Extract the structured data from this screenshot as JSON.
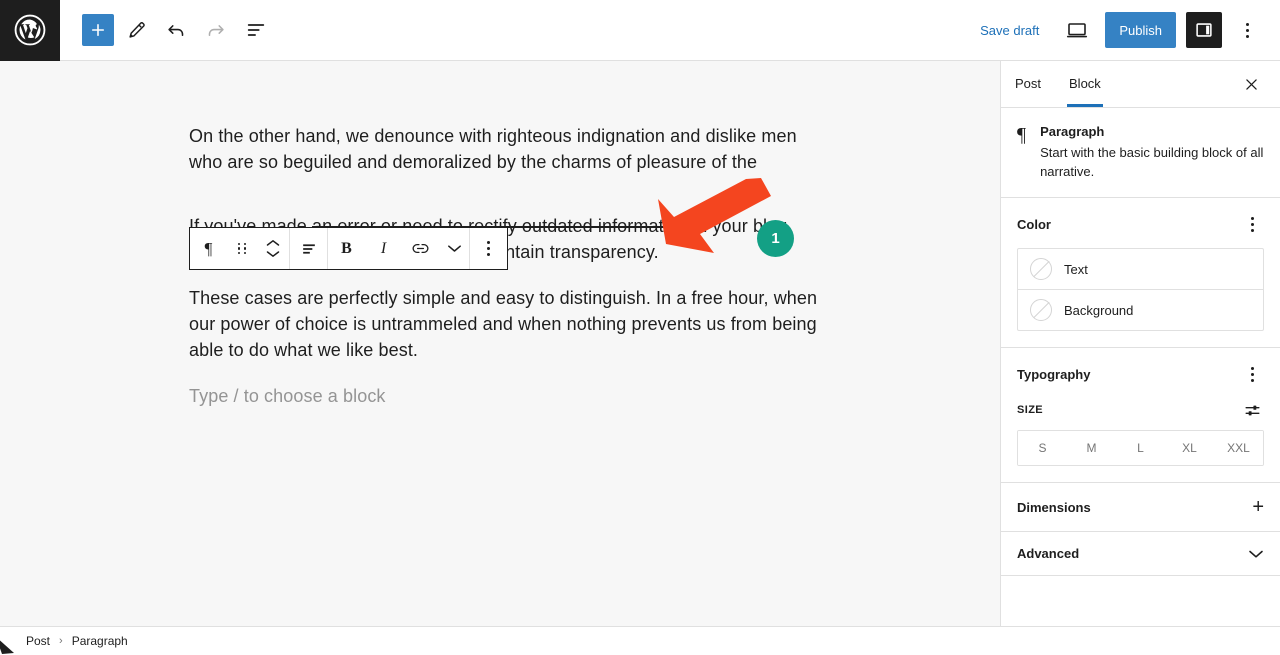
{
  "topbar": {
    "logo_icon": "wordpress-logo-icon",
    "add_block_label": "+",
    "add_block_icon": "plus-icon",
    "tools_icon": "pencil-edit-icon",
    "undo_icon": "undo-arrow-icon",
    "redo_icon": "redo-arrow-icon",
    "list_view_icon": "document-list-view-icon",
    "save_draft_label": "Save draft",
    "preview_icon": "desktop-preview-icon",
    "publish_label": "Publish",
    "sidebar_toggle_icon": "settings-panel-icon",
    "options_icon": "vertical-ellipsis-icon",
    "accent_blue": "#3582c4",
    "link_blue": "#1d70b8",
    "dark": "#1e1e1e"
  },
  "block_toolbar": {
    "block_type_icon": "paragraph-pilcrow-icon",
    "block_type_glyph": "¶",
    "drag_icon": "drag-handle-icon",
    "move_up_icon": "chevron-up-icon",
    "move_down_icon": "chevron-down-icon",
    "align_icon": "text-align-left-icon",
    "bold_label": "B",
    "italic_label": "I",
    "link_icon": "link-chain-icon",
    "more_formats_icon": "chevron-down-icon",
    "options_icon": "vertical-ellipsis-icon"
  },
  "editor": {
    "paragraph_1_line_1": "On the other hand, we denounce with righteous indignation and dislike men",
    "paragraph_1_line_2": "who are so beguiled and demoralized by the charms of pleasure of the",
    "paragraph_2_prefix": "If you've made ",
    "paragraph_2_strike": "an error or need to rectify outdated information",
    "paragraph_2_suffix": " in your blog post, using strikethrough helps you maintain transparency.",
    "paragraph_3": "These cases are perfectly simple and easy to distinguish. In a free hour, when our power of choice is untrammeled and when nothing prevents us from being able to do what we like best.",
    "placeholder": "Type / to choose a block"
  },
  "annotation": {
    "badge_number": "1",
    "badge_color": "#13a085",
    "arrow_color": "#f4451f",
    "arrow_icon": "pointer-arrow-icon"
  },
  "sidebar": {
    "tabs": [
      {
        "label": "Post",
        "active": false
      },
      {
        "label": "Block",
        "active": true
      }
    ],
    "close_icon": "close-x-icon",
    "block_card": {
      "icon": "paragraph-pilcrow-icon",
      "glyph": "¶",
      "title": "Paragraph",
      "description": "Start with the basic building block of all narrative."
    },
    "color_panel": {
      "title": "Color",
      "options_icon": "vertical-ellipsis-icon",
      "items": [
        {
          "label": "Text",
          "swatch_icon": "empty-color-swatch-icon"
        },
        {
          "label": "Background",
          "swatch_icon": "empty-color-swatch-icon"
        }
      ]
    },
    "typography_panel": {
      "title": "Typography",
      "options_icon": "vertical-ellipsis-icon",
      "size_label": "SIZE",
      "size_settings_icon": "sliders-settings-icon",
      "sizes": [
        "S",
        "M",
        "L",
        "XL",
        "XXL"
      ],
      "selected_size": ""
    },
    "dimensions_panel": {
      "title": "Dimensions",
      "toggle_icon": "plus-icon",
      "toggle_glyph": "+"
    },
    "advanced_panel": {
      "title": "Advanced",
      "toggle_icon": "chevron-down-icon"
    }
  },
  "footer": {
    "breadcrumbs": [
      "Post",
      "Paragraph"
    ],
    "separator": "›"
  }
}
